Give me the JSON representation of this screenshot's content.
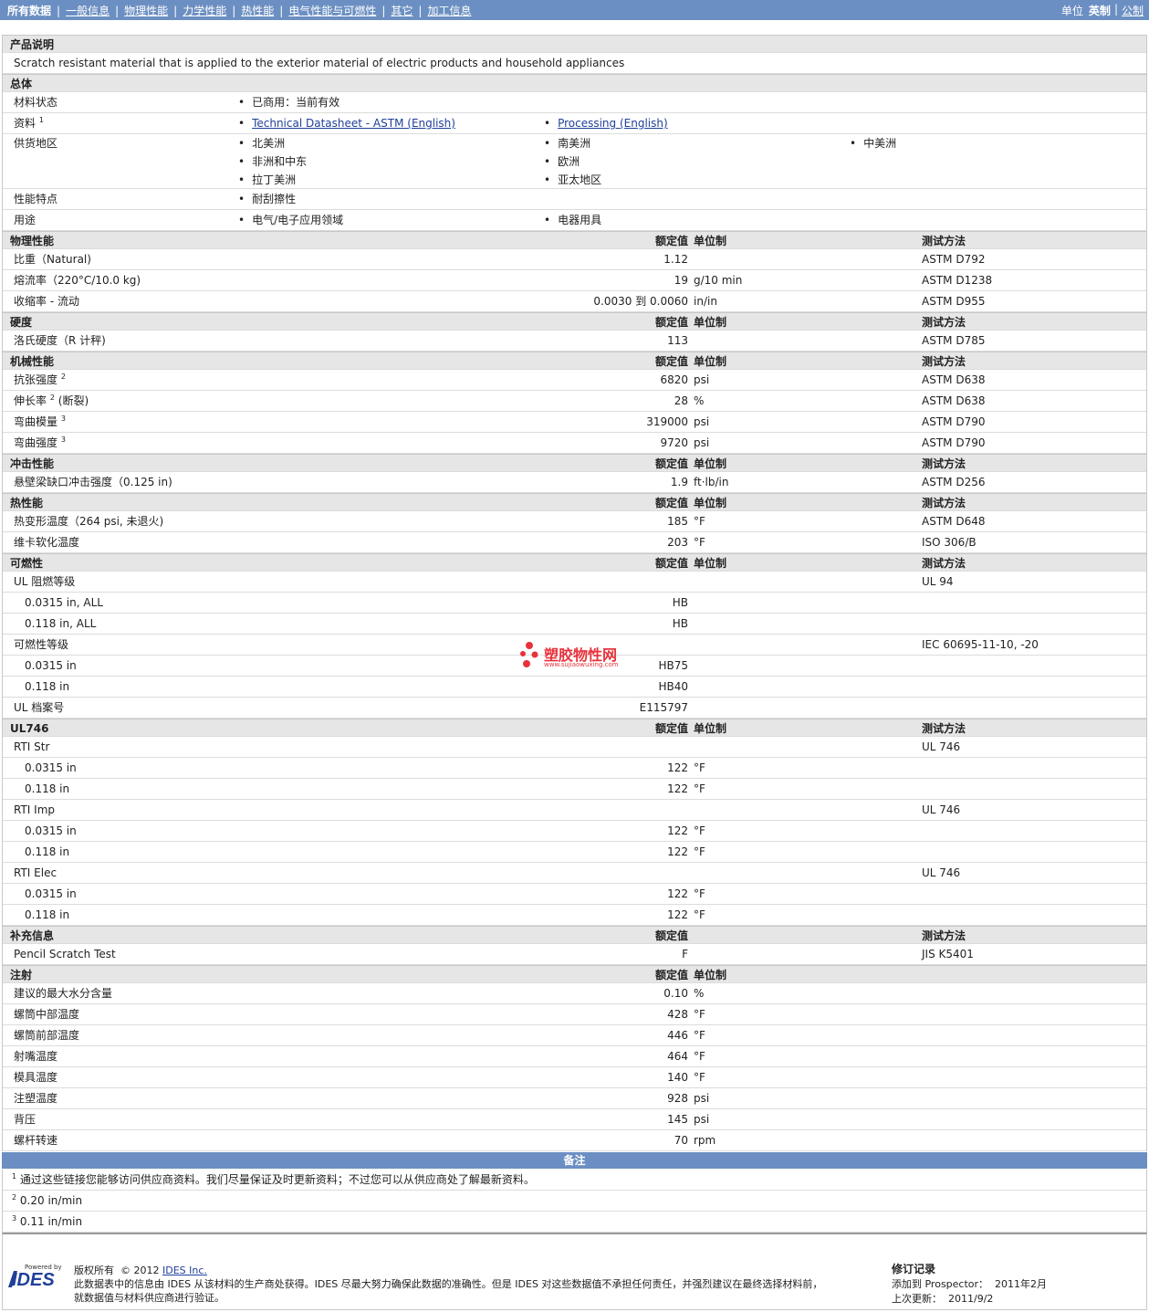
{
  "nav": {
    "tabs": [
      "所有数据",
      "一般信息",
      "物理性能",
      "力学性能",
      "热性能",
      "电气性能与可燃性",
      "其它",
      "加工信息"
    ],
    "units_label": "单位",
    "units_active": "英制",
    "units_other": "公制"
  },
  "columns": {
    "value": "额定值",
    "unit": "单位制",
    "method": "测试方法"
  },
  "product_desc": {
    "title": "产品说明",
    "text": "Scratch resistant material that is applied to the exterior material of electric products and household appliances"
  },
  "general": {
    "title": "总体",
    "status_label": "材料状态",
    "status_value": "已商用：当前有效",
    "docs_label": "资料",
    "docs_sup": "1",
    "docs": [
      "Technical Datasheet - ASTM (English)",
      "Processing (English)"
    ],
    "regions_label": "供货地区",
    "regions": [
      "北美洲",
      "南美洲",
      "中美洲",
      "非洲和中东",
      "欧洲",
      "拉丁美洲",
      "亚太地区"
    ],
    "features_label": "性能特点",
    "features": [
      "耐刮擦性"
    ],
    "uses_label": "用途",
    "uses": [
      "电气/电子应用领域",
      "电器用具"
    ]
  },
  "physical": {
    "title": "物理性能",
    "rows": [
      {
        "label": "比重（Natural)",
        "value": "1.12",
        "unit": "",
        "method": "ASTM D792"
      },
      {
        "label": "熔流率（220°C/10.0 kg)",
        "value": "19",
        "unit": "g/10 min",
        "method": "ASTM D1238"
      },
      {
        "label": "收缩率 - 流动",
        "value": "0.0030 到 0.0060",
        "unit": "in/in",
        "method": "ASTM D955"
      }
    ]
  },
  "hardness": {
    "title": "硬度",
    "rows": [
      {
        "label": "洛氏硬度（R 计秤)",
        "value": "113",
        "unit": "",
        "method": "ASTM D785"
      }
    ]
  },
  "mechanical": {
    "title": "机械性能",
    "rows": [
      {
        "label": "抗张强度",
        "sup": "2",
        "suffix": "",
        "value": "6820",
        "unit": "psi",
        "method": "ASTM D638"
      },
      {
        "label": "伸长率",
        "sup": "2",
        "suffix": "(断裂)",
        "value": "28",
        "unit": "%",
        "method": "ASTM D638"
      },
      {
        "label": "弯曲模量",
        "sup": "3",
        "suffix": "",
        "value": "319000",
        "unit": "psi",
        "method": "ASTM D790"
      },
      {
        "label": "弯曲强度",
        "sup": "3",
        "suffix": "",
        "value": "9720",
        "unit": "psi",
        "method": "ASTM D790"
      }
    ]
  },
  "impact": {
    "title": "冲击性能",
    "rows": [
      {
        "label": "悬壁梁缺口冲击强度（0.125 in)",
        "value": "1.9",
        "unit": "ft·lb/in",
        "method": "ASTM D256"
      }
    ]
  },
  "thermal": {
    "title": "热性能",
    "rows": [
      {
        "label": "热变形温度（264 psi, 未退火)",
        "value": "185",
        "unit": "°F",
        "method": "ASTM D648"
      },
      {
        "label": "维卡软化温度",
        "value": "203",
        "unit": "°F",
        "method": "ISO 306/B"
      }
    ]
  },
  "flammability": {
    "title": "可燃性",
    "ul_label": "UL 阻燃等级",
    "ul_method": "UL 94",
    "ul_rows": [
      {
        "label": "0.0315 in, ALL",
        "value": "HB"
      },
      {
        "label": "0.118 in, ALL",
        "value": "HB"
      }
    ],
    "fl_label": "可燃性等级",
    "fl_method": "IEC 60695-11-10, -20",
    "fl_rows": [
      {
        "label": "0.0315 in",
        "value": "HB75"
      },
      {
        "label": "0.118 in",
        "value": "HB40"
      }
    ],
    "file_label": "UL 档案号",
    "file_value": "E115797"
  },
  "ul746": {
    "title": "UL746",
    "groups": [
      {
        "label": "RTI Str",
        "method": "UL 746",
        "rows": [
          {
            "label": "0.0315 in",
            "value": "122",
            "unit": "°F"
          },
          {
            "label": "0.118 in",
            "value": "122",
            "unit": "°F"
          }
        ]
      },
      {
        "label": "RTI Imp",
        "method": "UL 746",
        "rows": [
          {
            "label": "0.0315 in",
            "value": "122",
            "unit": "°F"
          },
          {
            "label": "0.118 in",
            "value": "122",
            "unit": "°F"
          }
        ]
      },
      {
        "label": "RTI Elec",
        "method": "UL 746",
        "rows": [
          {
            "label": "0.0315 in",
            "value": "122",
            "unit": "°F"
          },
          {
            "label": "0.118 in",
            "value": "122",
            "unit": "°F"
          }
        ]
      }
    ]
  },
  "supplemental": {
    "title": "补充信息",
    "rows": [
      {
        "label": "Pencil Scratch Test",
        "value": "F",
        "method": "JIS K5401"
      }
    ]
  },
  "injection": {
    "title": "注射",
    "rows": [
      {
        "label": "建议的最大水分含量",
        "value": "0.10",
        "unit": "%"
      },
      {
        "label": "螺筒中部温度",
        "value": "428",
        "unit": "°F"
      },
      {
        "label": "螺筒前部温度",
        "value": "446",
        "unit": "°F"
      },
      {
        "label": "射嘴温度",
        "value": "464",
        "unit": "°F"
      },
      {
        "label": "模具温度",
        "value": "140",
        "unit": "°F"
      },
      {
        "label": "注塑温度",
        "value": "928",
        "unit": "psi"
      },
      {
        "label": "背压",
        "value": "145",
        "unit": "psi"
      },
      {
        "label": "螺杆转速",
        "value": "70",
        "unit": "rpm"
      }
    ]
  },
  "notes": {
    "title": "备注",
    "items": [
      {
        "num": "1",
        "text": "通过这些链接您能够访问供应商资料。我们尽量保证及时更新资料；不过您可以从供应商处了解最新资料。"
      },
      {
        "num": "2",
        "text": "0.20 in/min"
      },
      {
        "num": "3",
        "text": "0.11 in/min"
      }
    ]
  },
  "footer": {
    "powered_by": "Powered by",
    "logo": "IDES",
    "copyright_label": "版权所有",
    "copyright_year": "© 2012",
    "company": "IDES Inc.",
    "disclaimer_1": "此数据表中的信息由 IDES 从该材料的生产商处获得。IDES 尽最大努力确保此数据的准确性。但是 IDES 对这些数据值不承担任何责任，并强烈建议在最终选择材料前，",
    "disclaimer_2": "就数据值与材料供应商进行验证。",
    "rev_title": "修订记录",
    "added_label": "添加到 Prospector：",
    "added_value": "2011年2月",
    "updated_label": "上次更新：",
    "updated_value": "2011/9/2"
  },
  "watermark": {
    "text": "塑胶物性网",
    "url": "www.sujiaowuxing.com",
    "color": "#e8323c"
  },
  "colors": {
    "nav_bg": "#6b8fc2",
    "header_bg": "#e6e6e6",
    "link": "#1f3f99"
  }
}
